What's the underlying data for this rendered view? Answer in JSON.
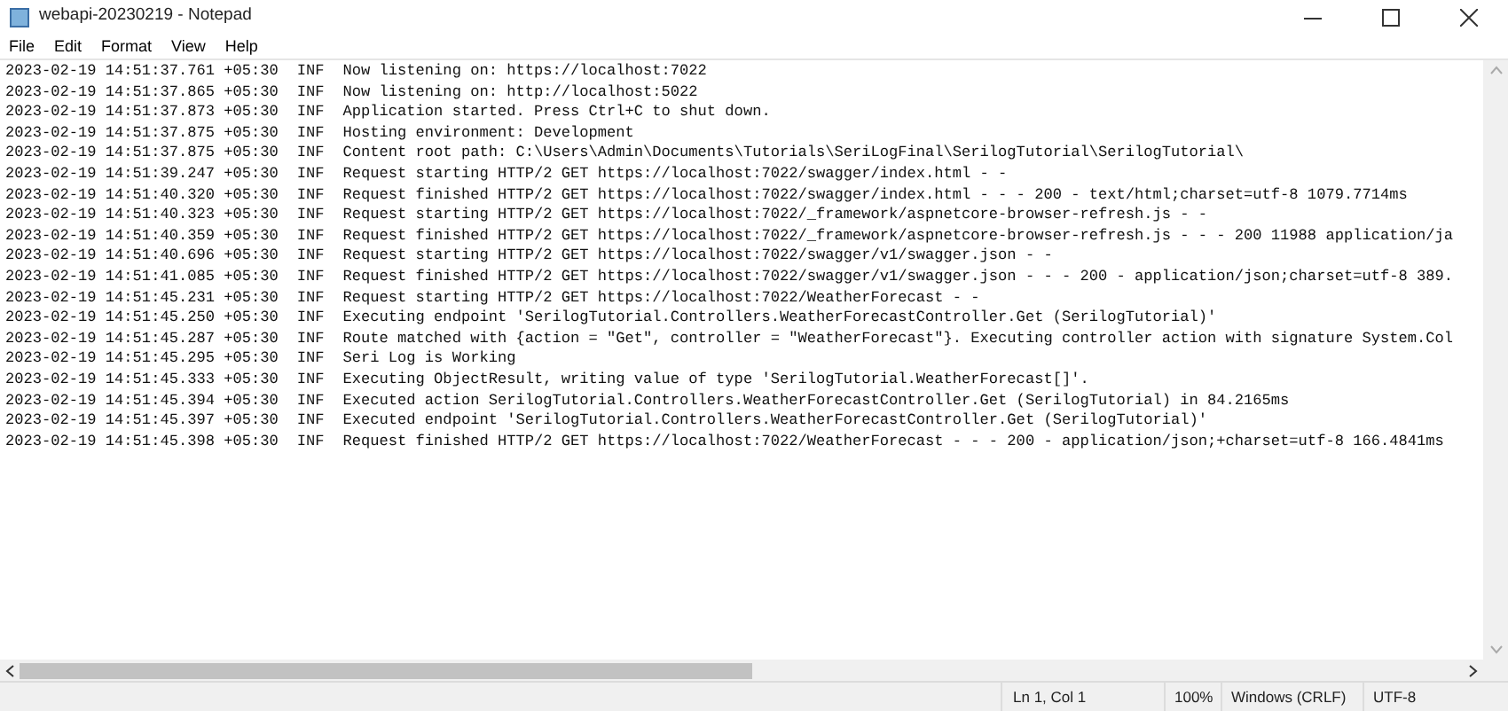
{
  "window": {
    "title": "webapi-20230219 - Notepad"
  },
  "menu": [
    "File",
    "Edit",
    "Format",
    "View",
    "Help"
  ],
  "lines": [
    {
      "timestamp": "2023-02-19 14:51:37.761 +05:30",
      "level": "INF",
      "message": "Now listening on: https://localhost:7022"
    },
    {
      "timestamp": "2023-02-19 14:51:37.865 +05:30",
      "level": "INF",
      "message": "Now listening on: http://localhost:5022"
    },
    {
      "timestamp": "2023-02-19 14:51:37.873 +05:30",
      "level": "INF",
      "message": "Application started. Press Ctrl+C to shut down."
    },
    {
      "timestamp": "2023-02-19 14:51:37.875 +05:30",
      "level": "INF",
      "message": "Hosting environment: Development"
    },
    {
      "timestamp": "2023-02-19 14:51:37.875 +05:30",
      "level": "INF",
      "message": "Content root path: C:\\Users\\Admin\\Documents\\Tutorials\\SeriLogFinal\\SerilogTutorial\\SerilogTutorial\\"
    },
    {
      "timestamp": "2023-02-19 14:51:39.247 +05:30",
      "level": "INF",
      "message": "Request starting HTTP/2 GET https://localhost:7022/swagger/index.html - -"
    },
    {
      "timestamp": "2023-02-19 14:51:40.320 +05:30",
      "level": "INF",
      "message": "Request finished HTTP/2 GET https://localhost:7022/swagger/index.html - - - 200 - text/html;charset=utf-8 1079.7714ms"
    },
    {
      "timestamp": "2023-02-19 14:51:40.323 +05:30",
      "level": "INF",
      "message": "Request starting HTTP/2 GET https://localhost:7022/_framework/aspnetcore-browser-refresh.js - -"
    },
    {
      "timestamp": "2023-02-19 14:51:40.359 +05:30",
      "level": "INF",
      "message": "Request finished HTTP/2 GET https://localhost:7022/_framework/aspnetcore-browser-refresh.js - - - 200 11988 application/ja"
    },
    {
      "timestamp": "2023-02-19 14:51:40.696 +05:30",
      "level": "INF",
      "message": "Request starting HTTP/2 GET https://localhost:7022/swagger/v1/swagger.json - -"
    },
    {
      "timestamp": "2023-02-19 14:51:41.085 +05:30",
      "level": "INF",
      "message": "Request finished HTTP/2 GET https://localhost:7022/swagger/v1/swagger.json - - - 200 - application/json;charset=utf-8 389."
    },
    {
      "timestamp": "2023-02-19 14:51:45.231 +05:30",
      "level": "INF",
      "message": "Request starting HTTP/2 GET https://localhost:7022/WeatherForecast - -"
    },
    {
      "timestamp": "2023-02-19 14:51:45.250 +05:30",
      "level": "INF",
      "message": "Executing endpoint 'SerilogTutorial.Controllers.WeatherForecastController.Get (SerilogTutorial)'"
    },
    {
      "timestamp": "2023-02-19 14:51:45.287 +05:30",
      "level": "INF",
      "message": "Route matched with {action = \"Get\", controller = \"WeatherForecast\"}. Executing controller action with signature System.Col"
    },
    {
      "timestamp": "2023-02-19 14:51:45.295 +05:30",
      "level": "INF",
      "message": "Seri Log is Working"
    },
    {
      "timestamp": "2023-02-19 14:51:45.333 +05:30",
      "level": "INF",
      "message": "Executing ObjectResult, writing value of type 'SerilogTutorial.WeatherForecast[]'."
    },
    {
      "timestamp": "2023-02-19 14:51:45.394 +05:30",
      "level": "INF",
      "message": "Executed action SerilogTutorial.Controllers.WeatherForecastController.Get (SerilogTutorial) in 84.2165ms"
    },
    {
      "timestamp": "2023-02-19 14:51:45.397 +05:30",
      "level": "INF",
      "message": "Executed endpoint 'SerilogTutorial.Controllers.WeatherForecastController.Get (SerilogTutorial)'"
    },
    {
      "timestamp": "2023-02-19 14:51:45.398 +05:30",
      "level": "INF",
      "message": "Request finished HTTP/2 GET https://localhost:7022/WeatherForecast - - - 200 - application/json;+charset=utf-8 166.4841ms"
    }
  ],
  "status_bar": {
    "position": "Ln 1, Col 1",
    "zoom": "100%",
    "line_ending": "Windows (CRLF)",
    "encoding": "UTF-8"
  }
}
